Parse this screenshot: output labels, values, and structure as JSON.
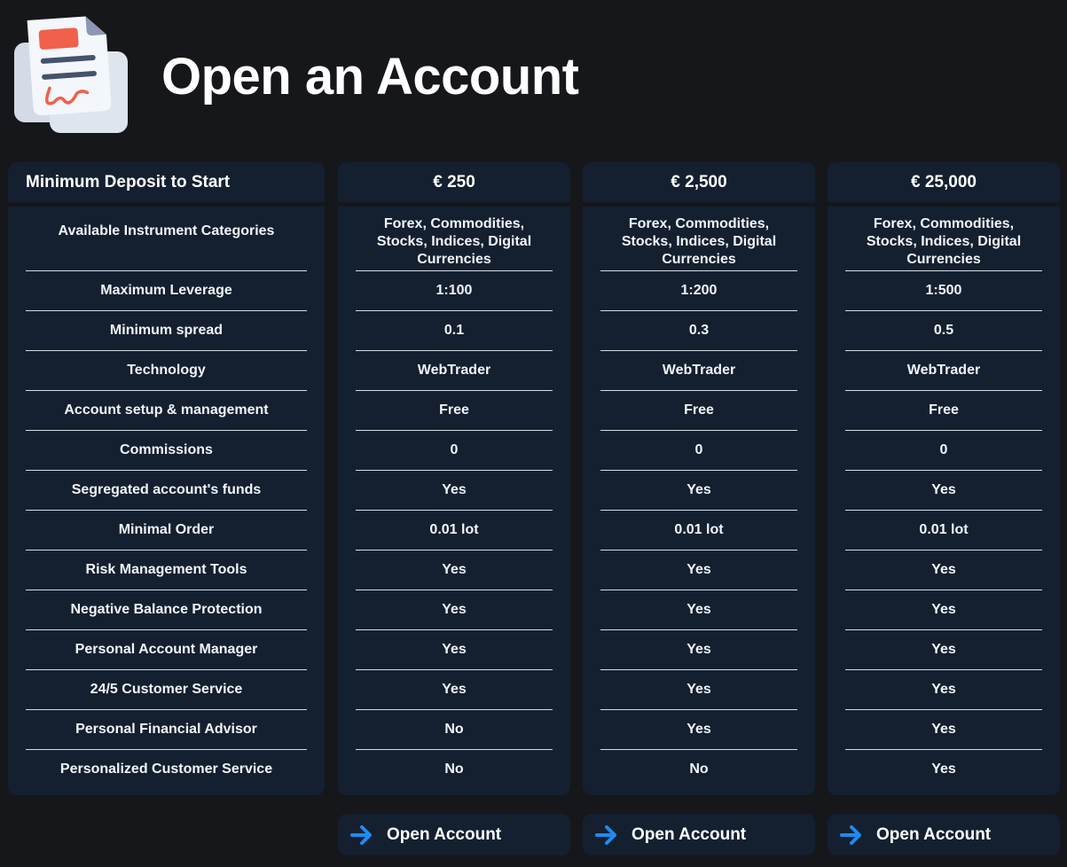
{
  "header": {
    "title": "Open an Account",
    "icon": "document-contract-icon"
  },
  "table": {
    "label_header": "Minimum Deposit to Start",
    "features": [
      "Available Instrument Categories",
      "Maximum Leverage",
      "Minimum spread",
      "Technology",
      "Account setup & management",
      "Commissions",
      "Segregated account's funds",
      "Minimal Order",
      "Risk Management Tools",
      "Negative Balance Protection",
      "Personal Account Manager",
      "24/5 Customer Service",
      "Personal Financial Advisor",
      "Personalized Customer Service"
    ],
    "plans": [
      {
        "deposit": "€ 250",
        "values": [
          "Forex, Commodities, Stocks, Indices, Digital Currencies",
          "1:100",
          "0.1",
          "WebTrader",
          "Free",
          "0",
          "Yes",
          "0.01 lot",
          "Yes",
          "Yes",
          "Yes",
          "Yes",
          "No",
          "No"
        ],
        "button_label": "Open Account"
      },
      {
        "deposit": "€ 2,500",
        "values": [
          "Forex, Commodities, Stocks, Indices, Digital Currencies",
          "1:200",
          "0.3",
          "WebTrader",
          "Free",
          "0",
          "Yes",
          "0.01 lot",
          "Yes",
          "Yes",
          "Yes",
          "Yes",
          "Yes",
          "No"
        ],
        "button_label": "Open Account"
      },
      {
        "deposit": "€ 25,000",
        "values": [
          "Forex, Commodities, Stocks, Indices, Digital Currencies",
          "1:500",
          "0.5",
          "WebTrader",
          "Free",
          "0",
          "Yes",
          "0.01 lot",
          "Yes",
          "Yes",
          "Yes",
          "Yes",
          "Yes",
          "Yes"
        ],
        "button_label": "Open Account"
      }
    ]
  },
  "colors": {
    "background": "#15171b",
    "panel": "#142030",
    "accent_arrow": "#1e8bf0",
    "icon_red": "#f0604a",
    "icon_line": "#44536b"
  }
}
